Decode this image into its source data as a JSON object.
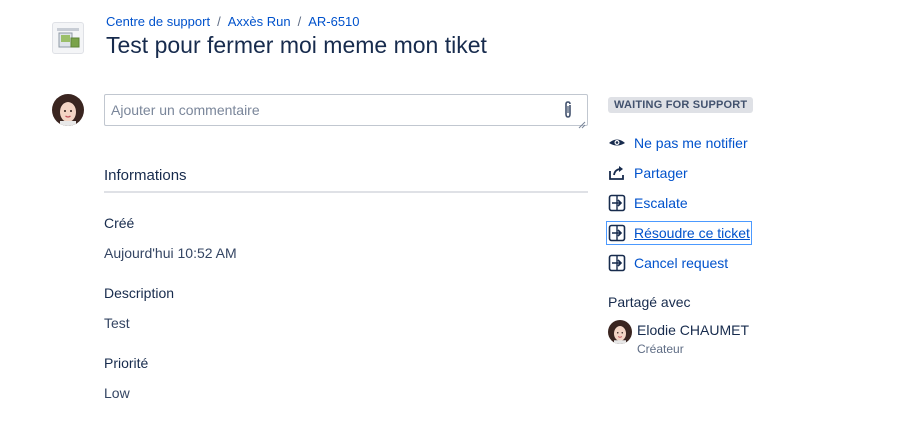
{
  "breadcrumb": {
    "items": [
      "Centre de support",
      "Axxès Run",
      "AR-6510"
    ],
    "separator": "/"
  },
  "project_icon": "project-avatar-icon",
  "issue": {
    "title": "Test pour fermer moi meme mon tiket"
  },
  "comment": {
    "placeholder": "Ajouter un commentaire",
    "value": "",
    "attach_icon": "paperclip-icon"
  },
  "details": {
    "section_title": "Informations",
    "fields": [
      {
        "label": "Créé",
        "value": "Aujourd'hui 10:52 AM"
      },
      {
        "label": "Description",
        "value": "Test"
      },
      {
        "label": "Priorité",
        "value": "Low"
      }
    ]
  },
  "status": {
    "label": "WAITING FOR SUPPORT",
    "color": "#dfe1e6"
  },
  "actions": [
    {
      "label": "Ne pas me notifier",
      "icon": "eye-icon"
    },
    {
      "label": "Partager",
      "icon": "share-icon"
    },
    {
      "label": "Escalate",
      "icon": "transition-icon"
    },
    {
      "label": "Résoudre ce ticket",
      "icon": "transition-icon"
    },
    {
      "label": "Cancel request",
      "icon": "transition-icon"
    }
  ],
  "shared": {
    "title": "Partagé avec",
    "person": {
      "name": "Elodie CHAUMET",
      "role": "Créateur"
    }
  },
  "colors": {
    "link": "#0052cc",
    "text": "#172b4d",
    "muted": "#5e6c84"
  }
}
